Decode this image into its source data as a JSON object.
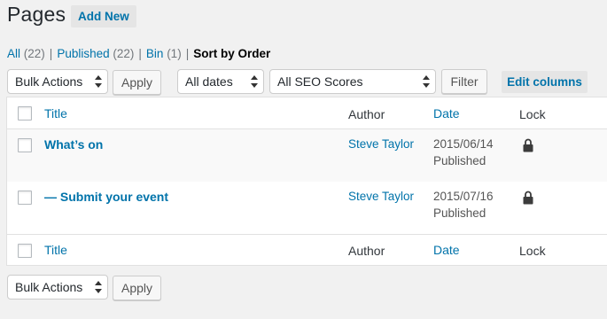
{
  "header": {
    "title": "Pages",
    "add_new": "Add New"
  },
  "filters": {
    "all_label": "All",
    "all_count": "(22)",
    "published_label": "Published",
    "published_count": "(22)",
    "bin_label": "Bin",
    "bin_count": "(1)",
    "sort_by_order": "Sort by Order",
    "separator": "|"
  },
  "toolbar": {
    "bulk_actions": "Bulk Actions",
    "apply": "Apply",
    "all_dates": "All dates",
    "all_seo_scores": "All SEO Scores",
    "filter": "Filter",
    "edit_columns": "Edit columns"
  },
  "table": {
    "columns": {
      "title": "Title",
      "author": "Author",
      "date": "Date",
      "lock": "Lock"
    },
    "rows": [
      {
        "title": "What’s on",
        "author": "Steve Taylor",
        "date": "2015/06/14",
        "status": "Published",
        "lock_icon": "lock-icon"
      },
      {
        "title": "— Submit your event",
        "author": "Steve Taylor",
        "date": "2015/07/16",
        "status": "Published",
        "lock_icon": "lock-icon"
      }
    ]
  },
  "bottom_toolbar": {
    "bulk_actions": "Bulk Actions",
    "apply": "Apply"
  },
  "colors": {
    "link": "#0073aa",
    "background": "#f1f1f1",
    "text": "#23282d"
  }
}
